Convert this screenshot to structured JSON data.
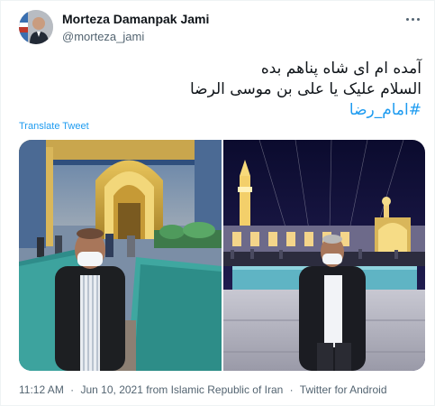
{
  "tweet": {
    "author": {
      "display_name": "Morteza Damanpak Jami",
      "handle": "@morteza_jami"
    },
    "text_line1": "آمده ام ای شاه پناهم بده",
    "text_line2": "السلام علیک یا علی بن موسی الرضا",
    "hashtag": "#امام_رضا",
    "translate_label": "Translate Tweet",
    "time": "11:12 AM",
    "date": "Jun 10, 2021",
    "location": "from Islamic Republic of Iran",
    "source": "Twitter for Android",
    "separator": "·"
  },
  "icons": {
    "more": "more-horizontal-icon"
  },
  "colors": {
    "link_blue": "#1d9bf0",
    "secondary_text": "#536471",
    "primary_text": "#0f1419"
  }
}
